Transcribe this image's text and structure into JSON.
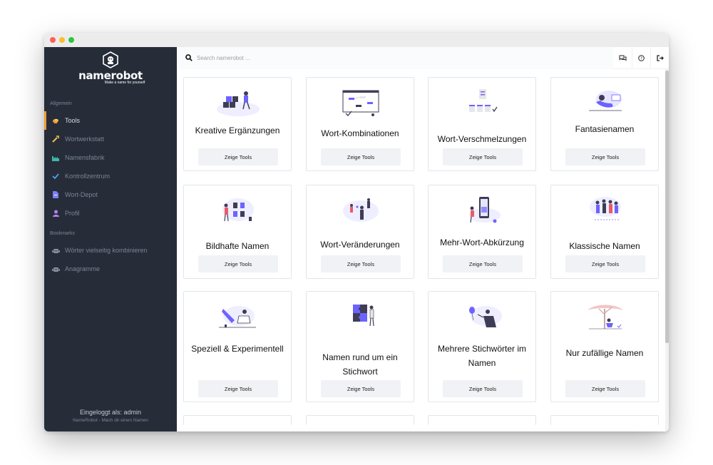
{
  "brand": {
    "name": "namerobot",
    "tagline": "Make a name for yourself"
  },
  "sidebar": {
    "section_general": "Allgemein",
    "items": [
      {
        "label": "Tools",
        "icon": "brain-icon",
        "active": true
      },
      {
        "label": "Wortwerkstatt",
        "icon": "wand-icon"
      },
      {
        "label": "Namensfabrik",
        "icon": "factory-icon"
      },
      {
        "label": "Kontrollzentrum",
        "icon": "check-icon"
      },
      {
        "label": "Wort-Depot",
        "icon": "file-icon"
      },
      {
        "label": "Profil",
        "icon": "user-icon"
      }
    ],
    "section_bookmarks": "Bookmarks",
    "bookmarks": [
      {
        "label": "Wörter vielseitig kombinieren",
        "icon": "robot-icon"
      },
      {
        "label": "Anagramme",
        "icon": "robot-icon"
      }
    ],
    "footer_user": "Eingeloggt als: admin",
    "footer_tagline": "NameRobot - Mach dir einen Namen"
  },
  "search": {
    "placeholder": "Search namerobot ..."
  },
  "colors": {
    "sidebar_bg": "#262d39",
    "accent": "#f39c33",
    "illustration": "#6c63ff"
  },
  "cards": [
    {
      "title": "Kreative Ergänzungen",
      "button": "Zeige Tools"
    },
    {
      "title": "Wort-Kombinationen",
      "button": "Zeige Tools"
    },
    {
      "title": "Wort-Verschmelzungen",
      "button": "Zeige Tools"
    },
    {
      "title": "Fantasienamen",
      "button": "Zeige Tools"
    },
    {
      "title": "Bildhafte Namen",
      "button": "Zeige Tools"
    },
    {
      "title": "Wort-Veränderungen",
      "button": "Zeige Tools"
    },
    {
      "title": "Mehr-Wort-Abkürzung",
      "button": "Zeige Tools"
    },
    {
      "title": "Klassische Namen",
      "button": "Zeige Tools"
    },
    {
      "title": "Speziell & Experimentell",
      "button": "Zeige Tools"
    },
    {
      "title": "Namen rund um ein Stichwort",
      "button": "Zeige Tools"
    },
    {
      "title": "Mehrere Stichwörter im Namen",
      "button": "Zeige Tools"
    },
    {
      "title": "Nur zufällige Namen",
      "button": "Zeige Tools"
    }
  ]
}
